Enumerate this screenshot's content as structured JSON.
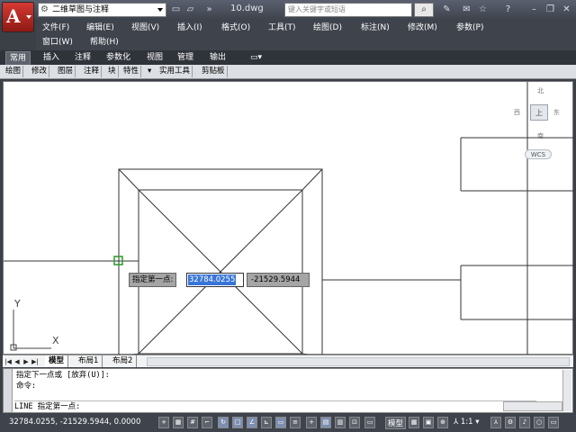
{
  "title_bar": {
    "workspace": "二维草图与注释",
    "doc_title": "10.dwg",
    "search_placeholder": "键入关键字或短语"
  },
  "menus": [
    "文件(F)",
    "编辑(E)",
    "视图(V)",
    "插入(I)",
    "格式(O)",
    "工具(T)",
    "绘图(D)",
    "标注(N)",
    "修改(M)",
    "参数(P)",
    "窗口(W)",
    "帮助(H)"
  ],
  "ribbon_tabs": [
    "常用",
    "插入",
    "注释",
    "参数化",
    "视图",
    "管理",
    "输出"
  ],
  "ribbon_panels": [
    "绘图",
    "修改",
    "图层",
    "注释",
    "块",
    "特性",
    "实用工具",
    "剪贴板"
  ],
  "viewcube": {
    "north": "北",
    "south": "南",
    "west": "西",
    "east": "东",
    "top_face": "上"
  },
  "wcs_label": "WCS",
  "dynamic_input": {
    "prompt": "指定第一点:",
    "x_value": "32784.0255",
    "y_value": "-21529.5944"
  },
  "ucs": {
    "y_axis": "Y",
    "x_axis": "X"
  },
  "layout_tabs": [
    "模型",
    "布局1",
    "布局2"
  ],
  "command_history": [
    "指定下一点或 [放弃(U)]:",
    "命令:"
  ],
  "command_input": "LINE 指定第一点:",
  "status_bar": {
    "coords": "32784.0255, -21529.5944, 0.0000",
    "model_label": "模型",
    "scale": "1:1"
  },
  "colors": {
    "app_button": "#c62f28",
    "title_bar": "#4a4f58",
    "canvas": "#ffffff",
    "highlight": "#3875d7",
    "pick_box": "#2a9a2a"
  }
}
